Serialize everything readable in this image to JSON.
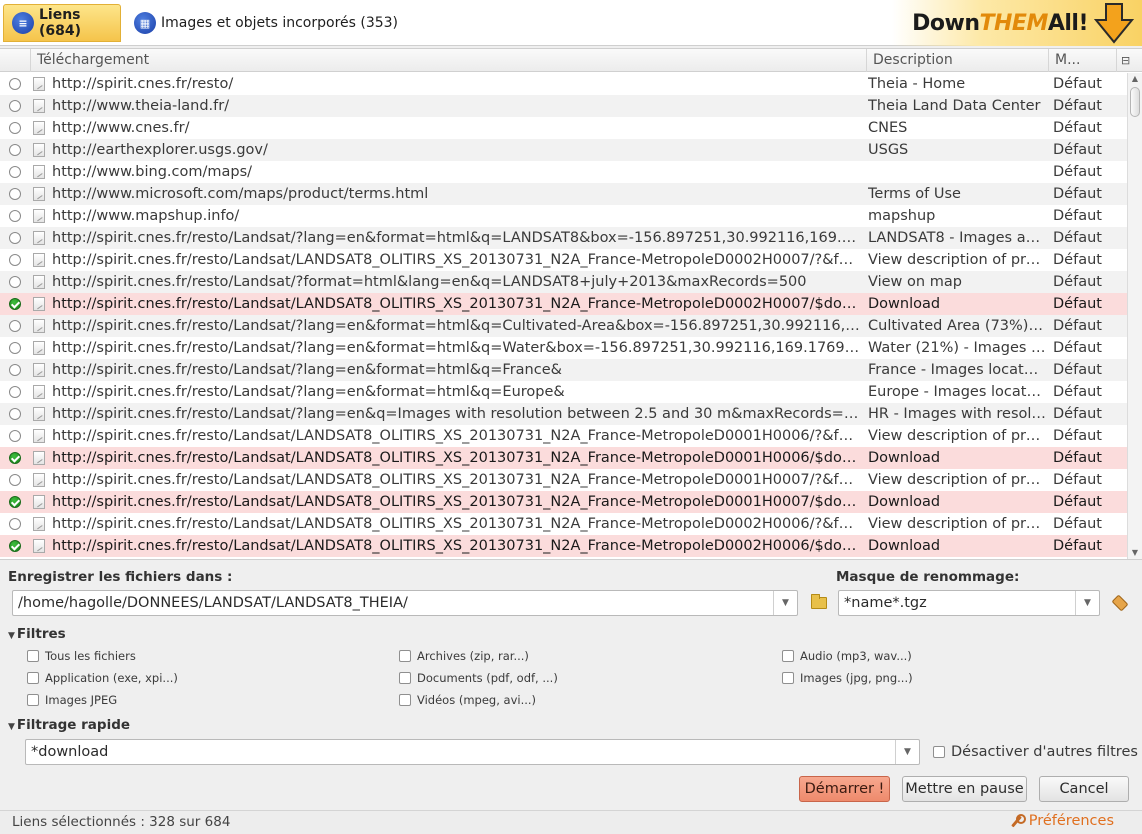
{
  "tabs": [
    {
      "label": "Liens (684)"
    },
    {
      "label": "Images et objets incorporés (353)"
    }
  ],
  "logo": {
    "part1": "Down",
    "part2": "THEM",
    "part3": "All!"
  },
  "table": {
    "columns": {
      "download": "Téléchargement",
      "description": "Description",
      "mask": "M..."
    },
    "rows": [
      {
        "url": "http://spirit.cnes.fr/resto/",
        "desc": "Theia - Home",
        "mask": "Défaut",
        "checked": false
      },
      {
        "url": "http://www.theia-land.fr/",
        "desc": "Theia Land Data Center",
        "mask": "Défaut",
        "checked": false
      },
      {
        "url": "http://www.cnes.fr/",
        "desc": "CNES",
        "mask": "Défaut",
        "checked": false
      },
      {
        "url": "http://earthexplorer.usgs.gov/",
        "desc": "USGS",
        "mask": "Défaut",
        "checked": false
      },
      {
        "url": "http://www.bing.com/maps/",
        "desc": "",
        "mask": "Défaut",
        "checked": false
      },
      {
        "url": "http://www.microsoft.com/maps/product/terms.html",
        "desc": "Terms of Use",
        "mask": "Défaut",
        "checked": false
      },
      {
        "url": "http://www.mapshup.info/",
        "desc": "mapshup",
        "mask": "Défaut",
        "checked": false
      },
      {
        "url": "http://spirit.cnes.fr/resto/Landsat/?lang=en&format=html&q=LANDSAT8&box=-156.897251,30.992116,169.176968,6...",
        "desc": "LANDSAT8 - Images acq...",
        "mask": "Défaut",
        "checked": false
      },
      {
        "url": "http://spirit.cnes.fr/resto/Landsat/LANDSAT8_OLITIRS_XS_20130731_N2A_France-MetropoleD0002H0007/?&format...",
        "desc": "View description of pro...",
        "mask": "Défaut",
        "checked": false
      },
      {
        "url": "http://spirit.cnes.fr/resto/Landsat/?format=html&lang=en&q=LANDSAT8+july+2013&maxRecords=500",
        "desc": "View on map",
        "mask": "Défaut",
        "checked": false
      },
      {
        "url": "http://spirit.cnes.fr/resto/Landsat/LANDSAT8_OLITIRS_XS_20130731_N2A_France-MetropoleD0002H0007/$download",
        "desc": "Download",
        "mask": "Défaut",
        "checked": true
      },
      {
        "url": "http://spirit.cnes.fr/resto/Landsat/?lang=en&format=html&q=Cultivated-Area&box=-156.897251,30.992116,169.176...",
        "desc": "Cultivated Area (73%) - I...",
        "mask": "Défaut",
        "checked": false
      },
      {
        "url": "http://spirit.cnes.fr/resto/Landsat/?lang=en&format=html&q=Water&box=-156.897251,30.992116,169.176968,65.19...",
        "desc": "Water (21%) - Images th...",
        "mask": "Défaut",
        "checked": false
      },
      {
        "url": "http://spirit.cnes.fr/resto/Landsat/?lang=en&format=html&q=France&",
        "desc": "France - Images located...",
        "mask": "Défaut",
        "checked": false
      },
      {
        "url": "http://spirit.cnes.fr/resto/Landsat/?lang=en&format=html&q=Europe&",
        "desc": "Europe - Images locate...",
        "mask": "Défaut",
        "checked": false
      },
      {
        "url": "http://spirit.cnes.fr/resto/Landsat/?lang=en&q=Images with resolution between 2.5 and 30 m&maxRecords=500&fo...",
        "desc": "HR - Images with resolu...",
        "mask": "Défaut",
        "checked": false
      },
      {
        "url": "http://spirit.cnes.fr/resto/Landsat/LANDSAT8_OLITIRS_XS_20130731_N2A_France-MetropoleD0001H0006/?&format...",
        "desc": "View description of pro...",
        "mask": "Défaut",
        "checked": false
      },
      {
        "url": "http://spirit.cnes.fr/resto/Landsat/LANDSAT8_OLITIRS_XS_20130731_N2A_France-MetropoleD0001H0006/$download",
        "desc": "Download",
        "mask": "Défaut",
        "checked": true
      },
      {
        "url": "http://spirit.cnes.fr/resto/Landsat/LANDSAT8_OLITIRS_XS_20130731_N2A_France-MetropoleD0001H0007/?&format...",
        "desc": "View description of pro...",
        "mask": "Défaut",
        "checked": false
      },
      {
        "url": "http://spirit.cnes.fr/resto/Landsat/LANDSAT8_OLITIRS_XS_20130731_N2A_France-MetropoleD0001H0007/$download",
        "desc": "Download",
        "mask": "Défaut",
        "checked": true
      },
      {
        "url": "http://spirit.cnes.fr/resto/Landsat/LANDSAT8_OLITIRS_XS_20130731_N2A_France-MetropoleD0002H0006/?&format...",
        "desc": "View description of pro...",
        "mask": "Défaut",
        "checked": false
      },
      {
        "url": "http://spirit.cnes.fr/resto/Landsat/LANDSAT8_OLITIRS_XS_20130731_N2A_France-MetropoleD0002H0006/$download",
        "desc": "Download",
        "mask": "Défaut",
        "checked": true
      }
    ]
  },
  "save": {
    "label": "Enregistrer les fichiers dans :",
    "path": "/home/hagolle/DONNEES/LANDSAT/LANDSAT8_THEIA/"
  },
  "rename": {
    "label": "Masque de renommage:",
    "value": "*name*.tgz"
  },
  "filters": {
    "title": "Filtres",
    "items": [
      "Tous les fichiers",
      "Archives (zip, rar...)",
      "Audio (mp3, wav...)",
      "Application (exe, xpi...)",
      "Documents (pdf, odf, ...)",
      "Images (jpg, png...)",
      "Images JPEG",
      "Vidéos (mpeg, avi...)"
    ]
  },
  "quickfilter": {
    "title": "Filtrage rapide",
    "value": "*download",
    "disable_others": "Désactiver d'autres filtres"
  },
  "buttons": {
    "start": "Démarrer !",
    "pause": "Mettre en pause",
    "cancel": "Cancel"
  },
  "status": {
    "selected": "Liens sélectionnés : 328 sur 684",
    "prefs": "Préférences"
  },
  "colors": {
    "tab_active": "#f5c44b",
    "row_selected": "#fbdcdc",
    "start_button": "#ee8a6c",
    "prefs_link": "#e07020"
  }
}
